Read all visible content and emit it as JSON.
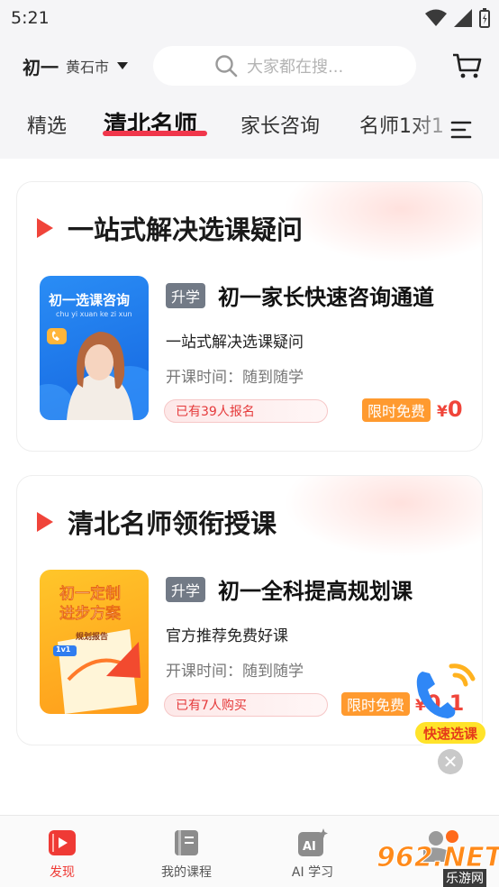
{
  "status_bar": {
    "time": "5:21"
  },
  "header": {
    "grade": "初一",
    "city": "黄石市",
    "search_placeholder": "大家都在搜..."
  },
  "tabs": [
    {
      "label": "精选"
    },
    {
      "label": "清北名师"
    },
    {
      "label": "家长咨询"
    },
    {
      "label": "名师1对1"
    }
  ],
  "cards": [
    {
      "title": "一站式解决选课疑问",
      "thumb_title": "初一选课咨询",
      "thumb_pinyin": "chu yi xuan ke zi xun",
      "tag": "升学",
      "course_name": "初一家长快速咨询通道",
      "subtitle": "一站式解决选课疑问",
      "time": "开课时间：随到随学",
      "enrolled": "已有39人报名",
      "free_label": "限时免费",
      "price_symbol": "¥",
      "price": "0"
    },
    {
      "title": "清北名师领衔授课",
      "thumb_title_line1": "初一定制",
      "thumb_title_line2": "进步方案",
      "thumb_report": "规划报告",
      "thumb_badge": "1v1",
      "tag": "升学",
      "course_name": "初一全科提高规划课",
      "subtitle": "官方推荐免费好课",
      "time": "开课时间：随到随学",
      "enrolled": "已有7人购买",
      "free_label": "限时免费",
      "price_symbol": "¥",
      "price": "0.1"
    }
  ],
  "float_widget": {
    "label": "快速选课"
  },
  "bottom_nav": [
    {
      "label": "发现",
      "icon": "video-icon",
      "active": true
    },
    {
      "label": "我的课程",
      "icon": "book-icon",
      "active": false
    },
    {
      "label": "AI 学习",
      "icon": "ai-icon",
      "active": false
    }
  ],
  "watermark": {
    "text": "962.NET",
    "sub": "乐游网"
  },
  "colors": {
    "accent": "#f0364b",
    "orange": "#ff9a2f",
    "price": "#f0453a"
  }
}
